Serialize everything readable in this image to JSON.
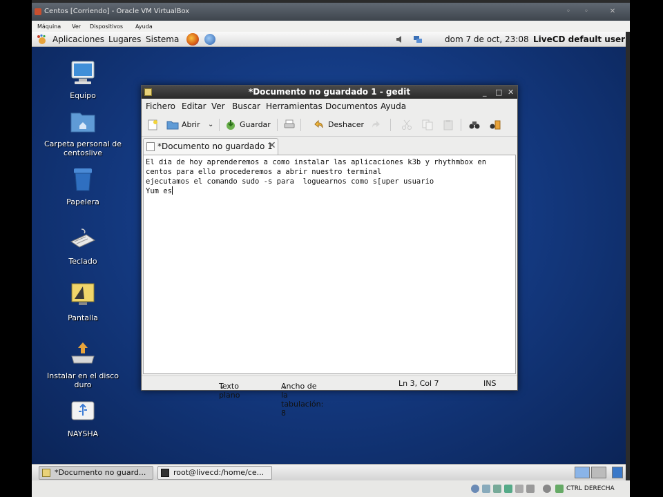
{
  "vbox": {
    "title": "Centos [Corriendo] - Oracle VM VirtualBox",
    "menu": [
      "Máquina",
      "Ver",
      "Dispositivos",
      "Ayuda"
    ],
    "status_host_key": "CTRL DERECHA"
  },
  "top_panel": {
    "menu_aplicaciones": "Aplicaciones",
    "menu_lugares": "Lugares",
    "menu_sistema": "Sistema",
    "clock": "dom  7 de oct, 23:08",
    "user": "LiveCD default user"
  },
  "desktop_icons": [
    {
      "label": "Equipo",
      "icon": "computer-icon"
    },
    {
      "label": "Carpeta personal de centoslive",
      "icon": "home-folder-icon"
    },
    {
      "label": "Papelera",
      "icon": "trash-icon"
    },
    {
      "label": "Teclado",
      "icon": "keyboard-icon"
    },
    {
      "label": "Pantalla",
      "icon": "display-icon"
    },
    {
      "label": "Instalar en el disco duro",
      "icon": "install-icon"
    },
    {
      "label": "NAYSHA",
      "icon": "usb-drive-icon"
    }
  ],
  "gedit": {
    "title": "*Documento no guardado 1 - gedit",
    "menu": [
      "Fichero",
      "Editar",
      "Ver",
      "Buscar",
      "Herramientas",
      "Documentos",
      "Ayuda"
    ],
    "toolbar": {
      "open": "Abrir",
      "save": "Guardar",
      "undo": "Deshacer"
    },
    "tab_label": "*Documento no guardado 1",
    "lines": [
      "El dia de hoy aprenderemos a como instalar las aplicaciones k3b y rhythmbox en",
      "centos para ello procederemos a abrir nuestro terminal",
      "ejecutamos el comando sudo -s para  loguearnos como s[uper usuario",
      "Yum es"
    ],
    "status": {
      "syntax": "Texto plano",
      "tab_width": "Ancho de la tabulación:  8",
      "position": "Ln 3, Col 7",
      "mode": "INS"
    }
  },
  "taskbar": [
    {
      "label": "*Documento no guard...",
      "active": true
    },
    {
      "label": "root@livecd:/home/ce...",
      "active": false
    }
  ],
  "colors": {
    "desktop": "#143a82",
    "panel": "#e4e4e4",
    "gedit_title": "#333333"
  }
}
